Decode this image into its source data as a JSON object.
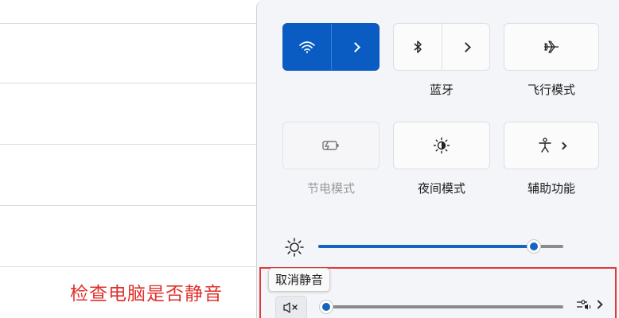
{
  "tiles": {
    "wifi": {
      "label": ""
    },
    "bluetooth": {
      "label": "蓝牙"
    },
    "airplane": {
      "label": "飞行模式"
    },
    "battery_saver": {
      "label": "节电模式"
    },
    "night_light": {
      "label": "夜间模式"
    },
    "accessibility": {
      "label": "辅助功能"
    }
  },
  "brightness": {
    "level_percent": 88
  },
  "volume": {
    "level_percent": 0,
    "tooltip": "取消静音",
    "muted": true
  },
  "annotation": {
    "text": "检查电脑是否静音"
  },
  "colors": {
    "accent": "#0a5cc2",
    "highlight": "#e03a3a"
  },
  "icons": [
    "wifi-icon",
    "bluetooth-icon",
    "airplane-icon",
    "battery-saver-icon",
    "night-light-icon",
    "accessibility-icon",
    "brightness-icon",
    "speaker-muted-icon",
    "audio-output-icon",
    "chevron-right-icon"
  ]
}
